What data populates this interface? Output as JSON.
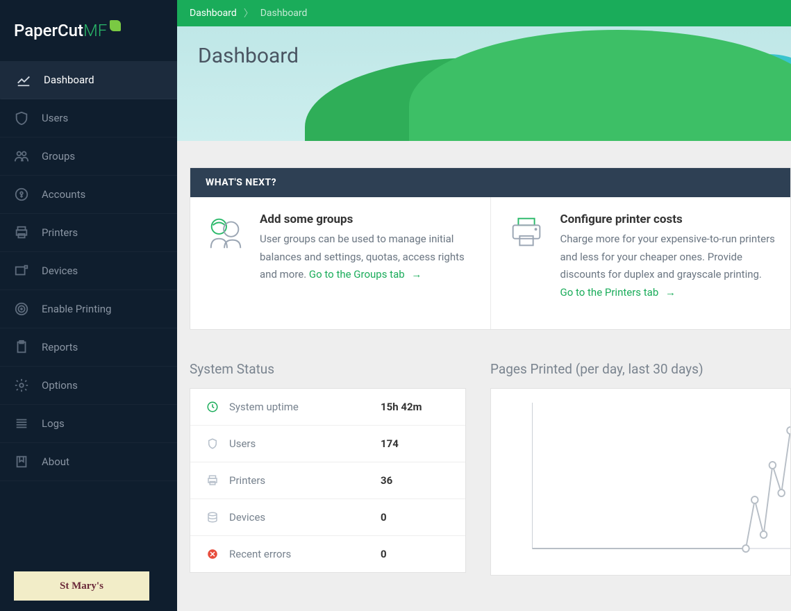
{
  "brand": {
    "name": "PaperCut",
    "suffix": "MF"
  },
  "sidebar": {
    "items": [
      {
        "label": "Dashboard",
        "icon": "chart-line-icon",
        "active": true
      },
      {
        "label": "Users",
        "icon": "shield-icon"
      },
      {
        "label": "Groups",
        "icon": "people-icon"
      },
      {
        "label": "Accounts",
        "icon": "key-icon"
      },
      {
        "label": "Printers",
        "icon": "printer-icon"
      },
      {
        "label": "Devices",
        "icon": "device-icon"
      },
      {
        "label": "Enable Printing",
        "icon": "target-icon"
      },
      {
        "label": "Reports",
        "icon": "clipboard-icon"
      },
      {
        "label": "Options",
        "icon": "gear-icon"
      },
      {
        "label": "Logs",
        "icon": "list-icon"
      },
      {
        "label": "About",
        "icon": "bookmark-icon"
      }
    ]
  },
  "org_badge": "St Mary's",
  "breadcrumb": {
    "items": [
      "Dashboard",
      "Dashboard"
    ]
  },
  "page_title": "Dashboard",
  "whats_next": {
    "heading": "WHAT'S NEXT?",
    "cards": [
      {
        "title": "Add some groups",
        "text": "User groups can be used to manage initial balances and settings, quotas, access rights and more.",
        "link": "Go to the Groups tab"
      },
      {
        "title": "Configure printer costs",
        "text": "Charge more for your expensive-to-run printers and less for your cheaper ones. Provide discounts for duplex and grayscale printing.",
        "link": "Go to the Printers tab"
      }
    ]
  },
  "system_status": {
    "heading": "System Status",
    "rows": [
      {
        "icon": "clock-icon",
        "label": "System uptime",
        "value": "15h 42m",
        "color": "#1aac5a"
      },
      {
        "icon": "shield-icon",
        "label": "Users",
        "value": "174",
        "color": "#9aa5b3"
      },
      {
        "icon": "printer-icon",
        "label": "Printers",
        "value": "36",
        "color": "#9aa5b3"
      },
      {
        "icon": "database-icon",
        "label": "Devices",
        "value": "0",
        "color": "#9aa5b3"
      },
      {
        "icon": "error-icon",
        "label": "Recent errors",
        "value": "0",
        "color": "#e74c3c"
      }
    ]
  },
  "chart": {
    "heading": "Pages Printed (per day, last 30 days)"
  },
  "chart_data": {
    "type": "line",
    "title": "Pages Printed (per day, last 30 days)",
    "xlabel": "",
    "ylabel": "",
    "series": [
      {
        "name": "Pages",
        "values": [
          0,
          0,
          0,
          0,
          0,
          0,
          0,
          0,
          0,
          0,
          0,
          0,
          0,
          0,
          0,
          0,
          0,
          0,
          0,
          0,
          0,
          0,
          0,
          0,
          0,
          35,
          10,
          60,
          40,
          85
        ]
      }
    ],
    "ylim": [
      0,
      100
    ]
  }
}
